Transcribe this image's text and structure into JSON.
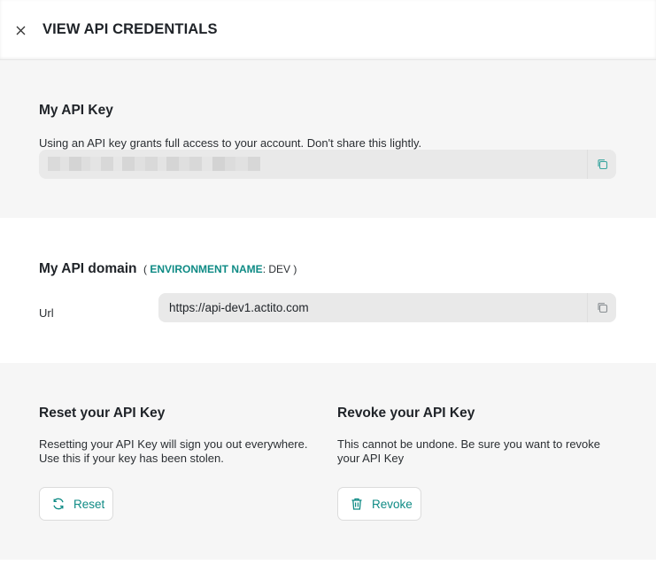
{
  "header": {
    "title": "VIEW API CREDENTIALS"
  },
  "api_key": {
    "title": "My API Key",
    "description": "Using an API key grants full access to your account. Don't share this lightly."
  },
  "api_domain": {
    "title": "My API domain",
    "env_open": "(",
    "env_label": "ENVIRONMENT NAME",
    "env_sep": ":",
    "env_value": "DEV",
    "env_close": ")",
    "url_label": "Url",
    "url_value": "https://api-dev1.actito.com"
  },
  "reset": {
    "title": "Reset your API Key",
    "description": "Resetting your API Key will sign you out everywhere. Use this if your key has been stolen.",
    "button_label": "Reset"
  },
  "revoke": {
    "title": "Revoke your API Key",
    "description": "This cannot be undone. Be sure you want to revoke your API Key",
    "button_label": "Revoke"
  },
  "colors": {
    "accent": "#0f8b85",
    "section_gray": "#f6f6f6",
    "field_bg": "#e9e9e9"
  },
  "icons": {
    "close": "close-icon",
    "copy": "copy-icon",
    "reset": "refresh-icon",
    "revoke": "trash-icon"
  }
}
